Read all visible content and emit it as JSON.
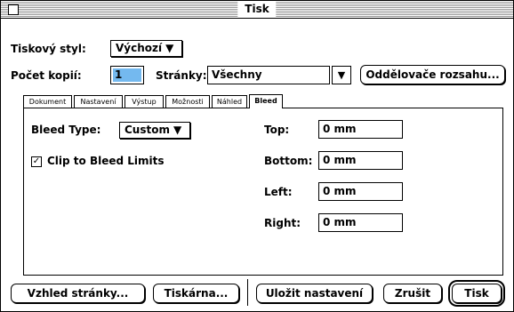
{
  "window": {
    "title": "Tisk"
  },
  "print_style": {
    "label": "Tiskový styl:",
    "value": "Výchozí"
  },
  "copies": {
    "label": "Počet kopií:",
    "value": "1"
  },
  "pages": {
    "label": "Stránky:",
    "value": "Všechny",
    "range_button": "Oddělovače rozsahu..."
  },
  "tabs": [
    "Dokument",
    "Nastavení",
    "Výstup",
    "Možnosti",
    "Náhled",
    "Bleed"
  ],
  "active_tab": "Bleed",
  "bleed": {
    "type_label": "Bleed Type:",
    "type_value": "Custom",
    "clip_label": "Clip to Bleed Limits",
    "clip_checked": true,
    "top_label": "Top:",
    "top_value": "0 mm",
    "bottom_label": "Bottom:",
    "bottom_value": "0 mm",
    "left_label": "Left:",
    "left_value": "0 mm",
    "right_label": "Right:",
    "right_value": "0 mm"
  },
  "footer": {
    "page_setup": "Vzhled stránky...",
    "printer": "Tiskárna...",
    "save_settings": "Uložit nastavení",
    "cancel": "Zrušit",
    "print": "Tisk"
  },
  "glyphs": {
    "dropdown_arrow": "▼",
    "checkmark": "✓"
  }
}
